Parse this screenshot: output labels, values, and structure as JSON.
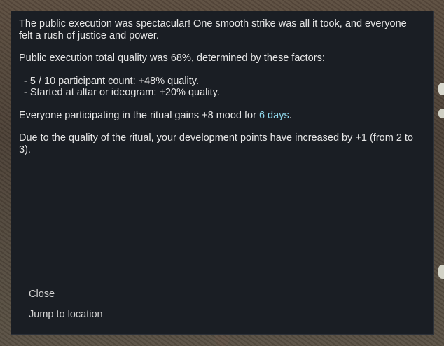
{
  "dialog": {
    "intro": "The public execution was spectacular! One smooth strike was all it took, and everyone felt a rush of justice and power.",
    "quality_summary": "Public execution total quality was 68%, determined by these factors:",
    "factors": [
      "- 5 / 10 participant count: +48% quality.",
      "- Started at altar or ideogram: +20% quality."
    ],
    "mood_text": "Everyone participating in the ritual gains +8 mood for ",
    "mood_duration": "6 days",
    "mood_end": ".",
    "development_text": "Due to the quality of the ritual, your development points have increased by +1 (from 2 to 3).",
    "highlight_color": "#8fd8ec"
  },
  "buttons": {
    "close": "Close",
    "jump": "Jump to location"
  }
}
